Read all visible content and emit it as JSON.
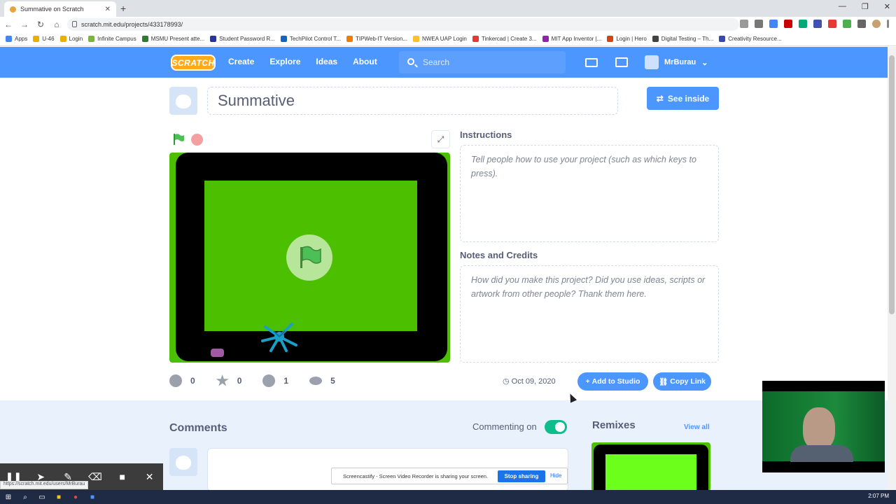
{
  "browser": {
    "tab_title": "Summative on Scratch",
    "url": "scratch.mit.edu/projects/433178993/",
    "bookmarks": [
      "Apps",
      "U-46",
      "Login",
      "Infinite Campus",
      "MSMU Present atte...",
      "Student Password R...",
      "TechPilot Control T...",
      "TIPWeb-IT Version...",
      "NWEA UAP Login",
      "Tinkercad | Create 3...",
      "MIT App Inventor |...",
      "Login | Hero",
      "Digital Testing – Th...",
      "Creativity Resource..."
    ]
  },
  "nav": {
    "logo": "SCRATCH",
    "links": [
      "Create",
      "Explore",
      "Ideas",
      "About"
    ],
    "search_placeholder": "Search",
    "username": "MrBurau"
  },
  "project": {
    "title": "Summative",
    "see_inside": "See inside",
    "instructions_heading": "Instructions",
    "instructions_placeholder": "Tell people how to use your project (such as which keys to press).",
    "notes_heading": "Notes and Credits",
    "notes_placeholder": "How did you make this project? Did you use ideas, scripts or artwork from other people? Thank them here.",
    "loves": "0",
    "favorites": "0",
    "remixes": "1",
    "views": "5",
    "date": "Oct 09, 2020",
    "add_to_studio": "Add to Studio",
    "copy_link": "Copy Link"
  },
  "lower": {
    "comments_heading": "Comments",
    "commenting_label": "Commenting on",
    "remixes_heading": "Remixes",
    "view_all": "View all"
  },
  "sharebar": {
    "message": "Screencastify - Screen Video Recorder is sharing your screen.",
    "stop": "Stop sharing",
    "hide": "Hide"
  },
  "status_url": "https://scratch.mit.edu/users/MrBurau",
  "clock": "2:07 PM",
  "colors": {
    "scratch_blue": "#4c97ff",
    "stage_green": "#4cbf00",
    "toggle_on": "#0fbd8c"
  }
}
